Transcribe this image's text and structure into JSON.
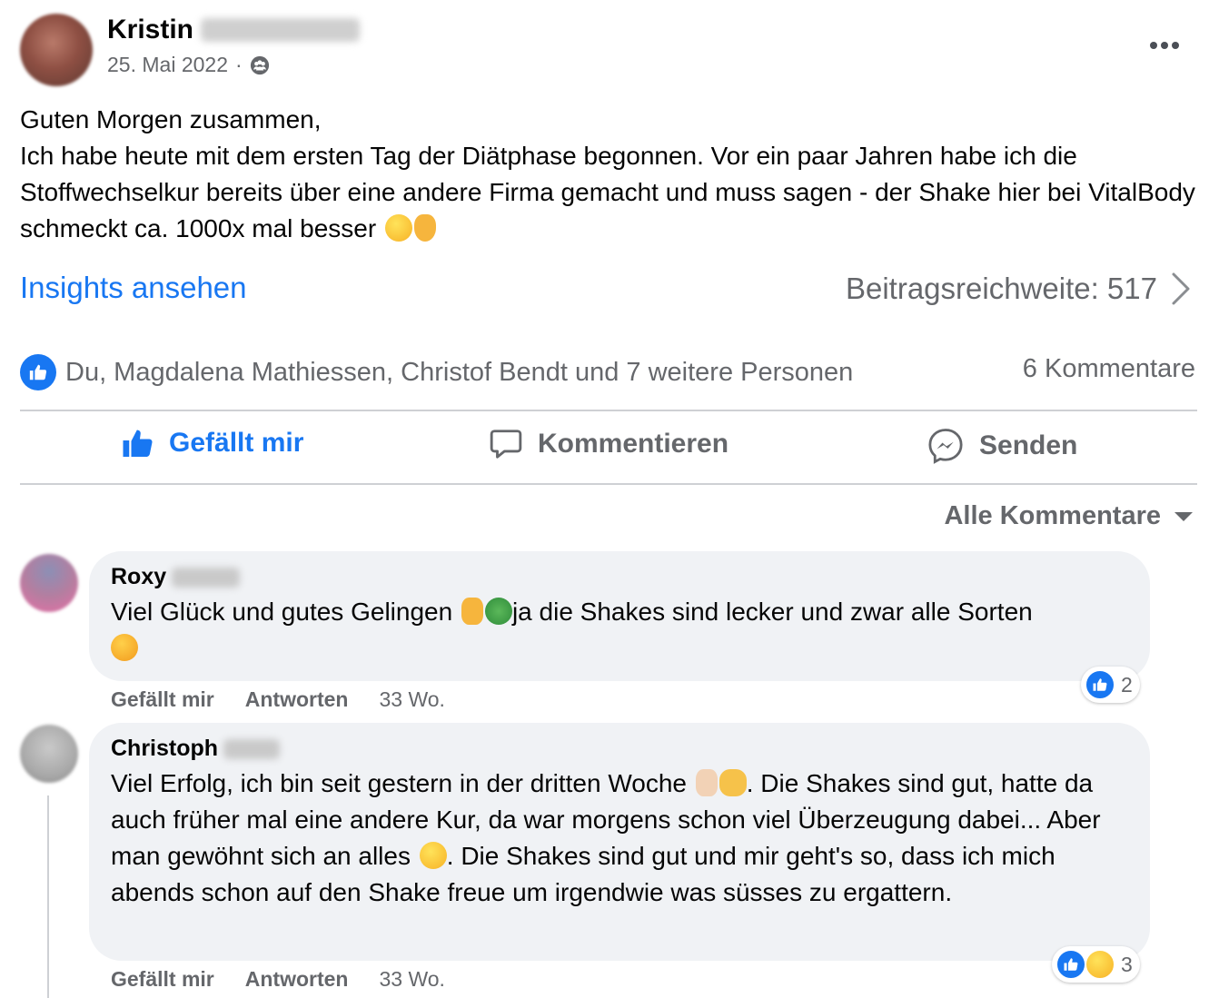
{
  "post": {
    "author_first_name": "Kristin",
    "date": "25. Mai 2022",
    "dot": "·",
    "more_icon": "more-horizontal-icon",
    "text_lines": [
      "Guten Morgen zusammen,",
      "Ich habe heute mit dem ersten Tag der Diätphase begonnen. Vor ein paar Jahren habe ich die Stoffwechselkur bereits über eine andere Firma gemacht und muss sagen - der Shake hier bei VitalBody schmeckt ca. 1000x mal besser"
    ],
    "text_emojis": [
      "grinning-sweat-emoji",
      "ok-hand-emoji"
    ]
  },
  "insights": {
    "link_label": "Insights ansehen",
    "reach_label": "Beitragsreichweite: 517"
  },
  "reactions": {
    "summary": "Du, Magdalena Mathiessen, Christof Bendt und 7 weitere Personen",
    "comments_count": "6 Kommentare"
  },
  "actions": {
    "like": "Gefällt mir",
    "comment": "Kommentieren",
    "send": "Senden"
  },
  "comments_filter": {
    "label": "Alle Kommentare"
  },
  "comments": [
    {
      "author_first_name": "Roxy",
      "text": "Viel Glück und gutes Gelingen",
      "text_after": "ja die Shakes sind lecker und zwar alle Sorten",
      "emojis": [
        "thumbs-up-emoji",
        "four-leaf-clover-emoji",
        "heart-eyes-emoji"
      ],
      "like_label": "Gefällt mir",
      "reply_label": "Antworten",
      "time": "33 Wo.",
      "reaction_count": "2"
    },
    {
      "author_first_name": "Christoph",
      "text_part1": "Viel Erfolg, ich bin seit gestern in der dritten Woche",
      "text_part2": ". Die Shakes sind gut, hatte da auch früher mal eine andere Kur, da war morgens schon viel Überzeugung dabei... Aber man gewöhnt sich an alles",
      "text_part3": ". Die Shakes sind gut und mir geht's so, dass ich mich abends schon auf den Shake freue um irgendwie was süsses zu ergattern.",
      "emojis": [
        "thumbs-up-emoji",
        "raising-hands-emoji",
        "laughing-emoji"
      ],
      "like_label": "Gefällt mir",
      "reply_label": "Antworten",
      "time": "33 Wo.",
      "reaction_count": "3"
    }
  ],
  "colors": {
    "accent": "#1877f2",
    "secondary_text": "#65676b",
    "bubble_bg": "#f0f2f5",
    "divider": "#ced0d4"
  }
}
